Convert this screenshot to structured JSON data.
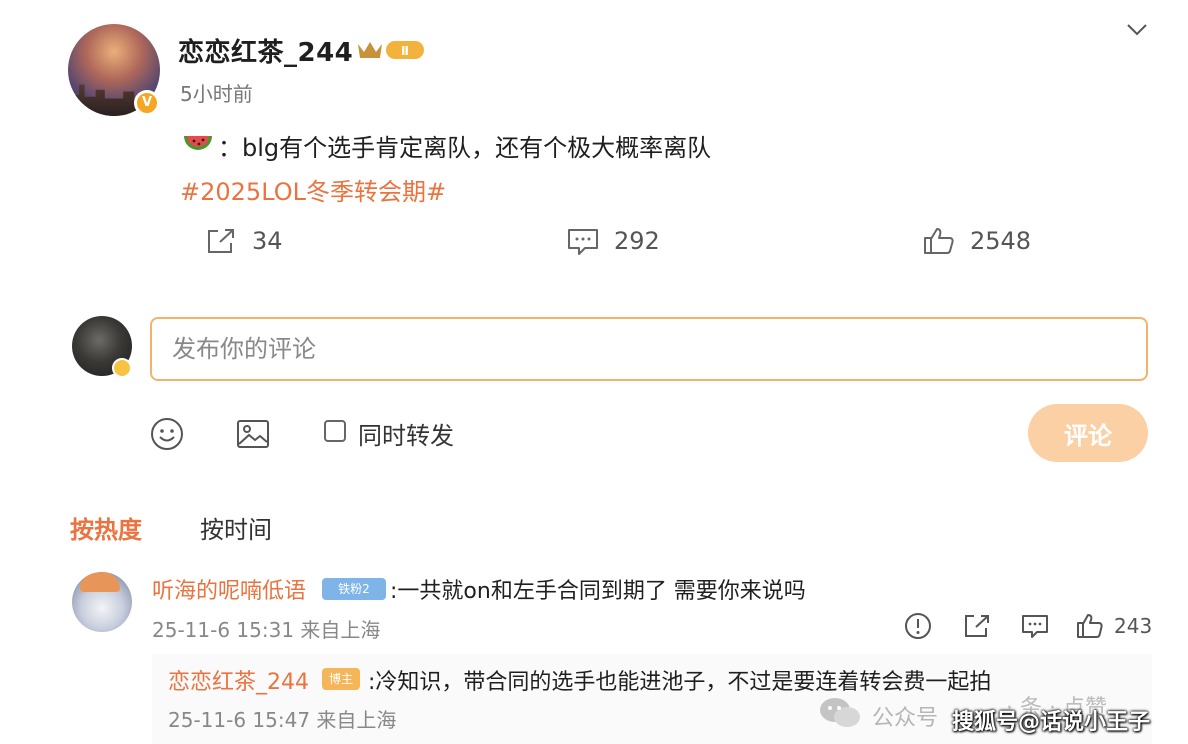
{
  "post": {
    "username": "恋恋红茶_244",
    "level_badge": "Ⅱ",
    "verified_badge": "V",
    "time": "5小时前",
    "emoji_icon": "watermelon-icon",
    "text": "：blg有个选手肯定离队，还有个极大概率离队",
    "hashtag": "#2025LOL冬季转会期#",
    "reposts": "34",
    "comments": "292",
    "likes": "2548"
  },
  "composer": {
    "placeholder": "发布你的评论",
    "repost_label": "同时转发",
    "submit_label": "评论"
  },
  "sort_tabs": {
    "hot": "按热度",
    "time": "按时间"
  },
  "comments": [
    {
      "user": "听海的呢喃低语",
      "badge": "铁粉2",
      "text": ":一共就on和左手合同到期了 需要你来说吗",
      "time": "25-11-6 15:31 来自上海",
      "likes": "243"
    }
  ],
  "reply": {
    "user": "恋恋红茶_244",
    "badge": "博主",
    "text": ":冷知识，带合同的选手也能进池子，不过是要连着转会费一起拍",
    "time": "25-11-6 15:47 来自上海",
    "faded_actions": "· 条 · 点赞"
  },
  "watermark": {
    "gzh": "公众号",
    "sohu": "搜狐号@话说小王子"
  },
  "colors": {
    "accent": "#eb7340",
    "input_border": "#f2b46a",
    "submit_bg": "#fbd0a5"
  }
}
